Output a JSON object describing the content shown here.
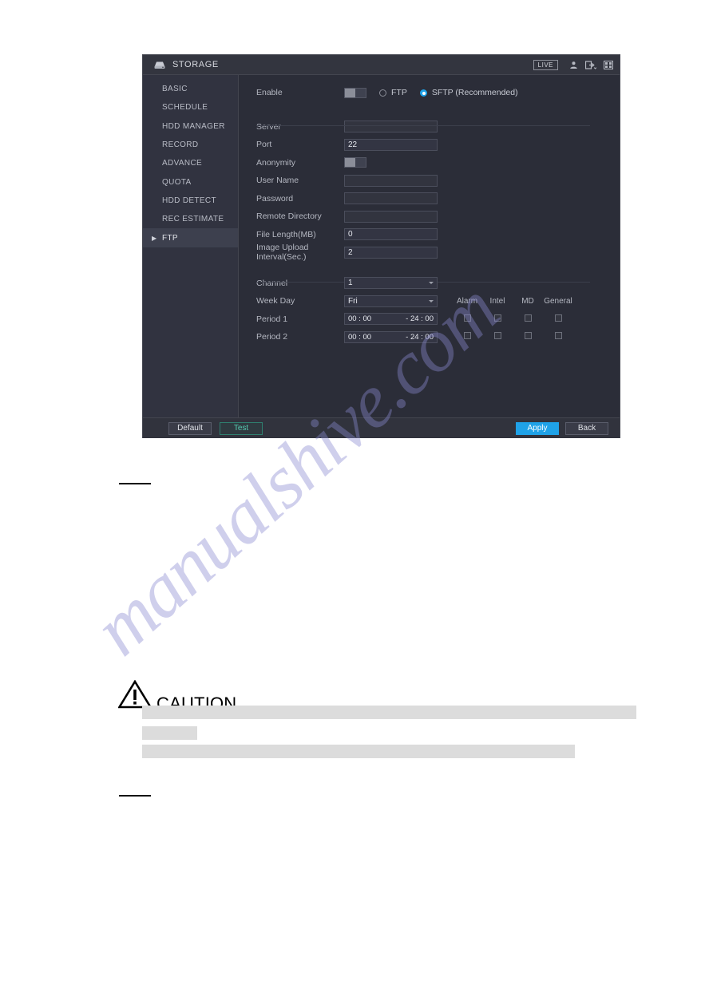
{
  "document": {
    "watermark": "manualshive.com",
    "caution_label": "CAUTION"
  },
  "window": {
    "title": "STORAGE",
    "icon": "hdd-icon",
    "live_badge": "LIVE",
    "titlebar_icons": [
      "user-icon",
      "logout-icon",
      "apps-grid-icon"
    ]
  },
  "sidebar": {
    "items": [
      {
        "label": "BASIC",
        "active": false
      },
      {
        "label": "SCHEDULE",
        "active": false
      },
      {
        "label": "HDD MANAGER",
        "active": false
      },
      {
        "label": "RECORD",
        "active": false
      },
      {
        "label": "ADVANCE",
        "active": false
      },
      {
        "label": "QUOTA",
        "active": false
      },
      {
        "label": "HDD DETECT",
        "active": false
      },
      {
        "label": "REC ESTIMATE",
        "active": false
      },
      {
        "label": "FTP",
        "active": true
      }
    ]
  },
  "form": {
    "enable": {
      "label": "Enable",
      "toggle_state": "off",
      "protocols": [
        {
          "label": "FTP",
          "selected": false
        },
        {
          "label": "SFTP (Recommended)",
          "selected": true
        }
      ]
    },
    "fields": [
      {
        "label": "Server",
        "value": ""
      },
      {
        "label": "Port",
        "value": "22"
      },
      {
        "label": "User Name",
        "value": ""
      },
      {
        "label": "Password",
        "value": ""
      },
      {
        "label": "Remote Directory",
        "value": ""
      },
      {
        "label": "File Length(MB)",
        "value": "0"
      },
      {
        "label": "Image Upload Interval(Sec.)",
        "value": "2"
      }
    ],
    "anonymity": {
      "label": "Anonymity",
      "toggle_state": "off"
    },
    "schedule": {
      "channel": {
        "label": "Channel",
        "value": "1"
      },
      "week_day": {
        "label": "Week Day",
        "value": "Fri"
      },
      "event_columns": [
        "Alarm",
        "Intel",
        "MD",
        "General"
      ],
      "periods": [
        {
          "label": "Period 1",
          "start": "00 : 00",
          "end": "- 24 : 00",
          "checks": [
            false,
            false,
            false,
            false
          ]
        },
        {
          "label": "Period 2",
          "start": "00 : 00",
          "end": "- 24 : 00",
          "checks": [
            false,
            false,
            false,
            false
          ]
        }
      ]
    }
  },
  "footer": {
    "default_label": "Default",
    "test_label": "Test",
    "apply_label": "Apply",
    "back_label": "Back"
  },
  "colors": {
    "accent": "#1fa2e8",
    "test_green": "#57c9b0",
    "panel_bg": "#2b2d38",
    "sidebar_bg": "#313340"
  }
}
